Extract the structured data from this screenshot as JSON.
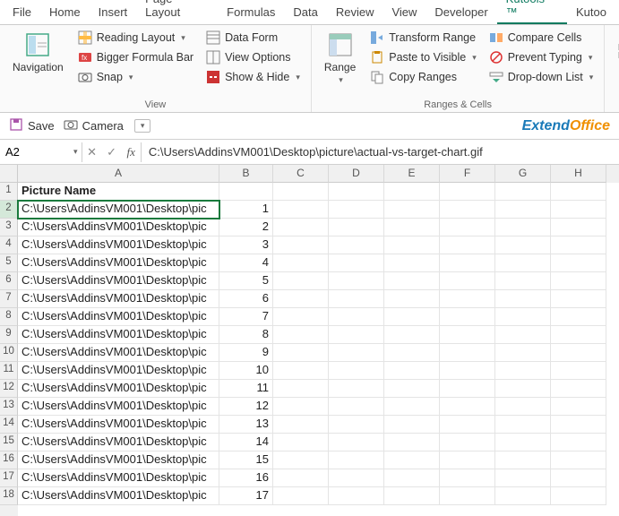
{
  "tabs": [
    "File",
    "Home",
    "Insert",
    "Page Layout",
    "Formulas",
    "Data",
    "Review",
    "View",
    "Developer",
    "Kutools ™",
    "Kutoo"
  ],
  "activeTab": 9,
  "ribbon": {
    "navigation": "Navigation",
    "readingLayout": "Reading Layout",
    "biggerFormulaBar": "Bigger Formula Bar",
    "snap": "Snap",
    "dataForm": "Data Form",
    "viewOptions": "View Options",
    "showHide": "Show & Hide",
    "viewGroup": "View",
    "range": "Range",
    "transformRange": "Transform Range",
    "pasteVisible": "Paste to Visible",
    "copyRanges": "Copy Ranges",
    "compareCells": "Compare Cells",
    "preventTyping": "Prevent Typing",
    "dropdownList": "Drop-down List",
    "rangesGroup": "Ranges & Cells"
  },
  "qat": {
    "save": "Save",
    "camera": "Camera"
  },
  "brand": {
    "part1": "Extend",
    "part2": "Office"
  },
  "formulaBar": {
    "cellRef": "A2",
    "content": "C:\\Users\\AddinsVM001\\Desktop\\picture\\actual-vs-target-chart.gif"
  },
  "columns": [
    "A",
    "B",
    "C",
    "D",
    "E",
    "F",
    "G",
    "H"
  ],
  "headerRow": {
    "A": "Picture Name"
  },
  "rows": [
    {
      "n": 2,
      "A": "C:\\Users\\AddinsVM001\\Desktop\\pic",
      "B": "1"
    },
    {
      "n": 3,
      "A": "C:\\Users\\AddinsVM001\\Desktop\\pic",
      "B": "2"
    },
    {
      "n": 4,
      "A": "C:\\Users\\AddinsVM001\\Desktop\\pic",
      "B": "3"
    },
    {
      "n": 5,
      "A": "C:\\Users\\AddinsVM001\\Desktop\\pic",
      "B": "4"
    },
    {
      "n": 6,
      "A": "C:\\Users\\AddinsVM001\\Desktop\\pic",
      "B": "5"
    },
    {
      "n": 7,
      "A": "C:\\Users\\AddinsVM001\\Desktop\\pic",
      "B": "6"
    },
    {
      "n": 8,
      "A": "C:\\Users\\AddinsVM001\\Desktop\\pic",
      "B": "7"
    },
    {
      "n": 9,
      "A": "C:\\Users\\AddinsVM001\\Desktop\\pic",
      "B": "8"
    },
    {
      "n": 10,
      "A": "C:\\Users\\AddinsVM001\\Desktop\\pic",
      "B": "9"
    },
    {
      "n": 11,
      "A": "C:\\Users\\AddinsVM001\\Desktop\\pic",
      "B": "10"
    },
    {
      "n": 12,
      "A": "C:\\Users\\AddinsVM001\\Desktop\\pic",
      "B": "11"
    },
    {
      "n": 13,
      "A": "C:\\Users\\AddinsVM001\\Desktop\\pic",
      "B": "12"
    },
    {
      "n": 14,
      "A": "C:\\Users\\AddinsVM001\\Desktop\\pic",
      "B": "13"
    },
    {
      "n": 15,
      "A": "C:\\Users\\AddinsVM001\\Desktop\\pic",
      "B": "14"
    },
    {
      "n": 16,
      "A": "C:\\Users\\AddinsVM001\\Desktop\\pic",
      "B": "15"
    },
    {
      "n": 17,
      "A": "C:\\Users\\AddinsVM001\\Desktop\\pic",
      "B": "16"
    },
    {
      "n": 18,
      "A": "C:\\Users\\AddinsVM001\\Desktop\\pic",
      "B": "17"
    }
  ],
  "selectedRow": 2
}
